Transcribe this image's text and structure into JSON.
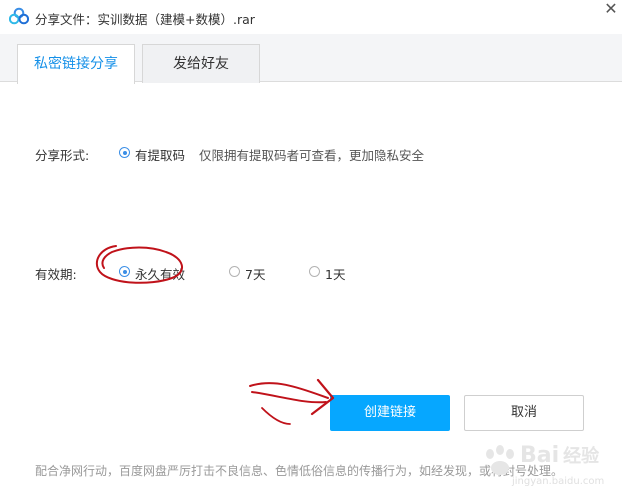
{
  "window": {
    "title": "分享文件：实训数据（建模+数模）.rar",
    "close_glyph": "✕"
  },
  "tabs": [
    {
      "label": "私密链接分享",
      "active": true
    },
    {
      "label": "发给好友",
      "active": false
    }
  ],
  "share_form": {
    "label": "分享形式:",
    "option": "有提取码",
    "option_checked": true,
    "hint": "仅限拥有提取码者可查看，更加隐私安全"
  },
  "validity": {
    "label": "有效期:",
    "options": [
      {
        "label": "永久有效",
        "checked": true
      },
      {
        "label": "7天",
        "checked": false
      },
      {
        "label": "1天",
        "checked": false
      }
    ]
  },
  "buttons": {
    "create": "创建链接",
    "cancel": "取消"
  },
  "footer": {
    "note": "配合净网行动，百度网盘严厉打击不良信息、色情低俗信息的传播行为，如经发现，或将封号处理。"
  },
  "watermark": {
    "brand": "Bai",
    "suffix": "经验",
    "url": "jingyan.baidu.com"
  },
  "colors": {
    "accent": "#1590e8",
    "primary_button": "#06a7ff",
    "annotation_red": "#c0121a"
  },
  "icons": {
    "app": "baidu-netdisk-icon",
    "close": "close-icon"
  }
}
